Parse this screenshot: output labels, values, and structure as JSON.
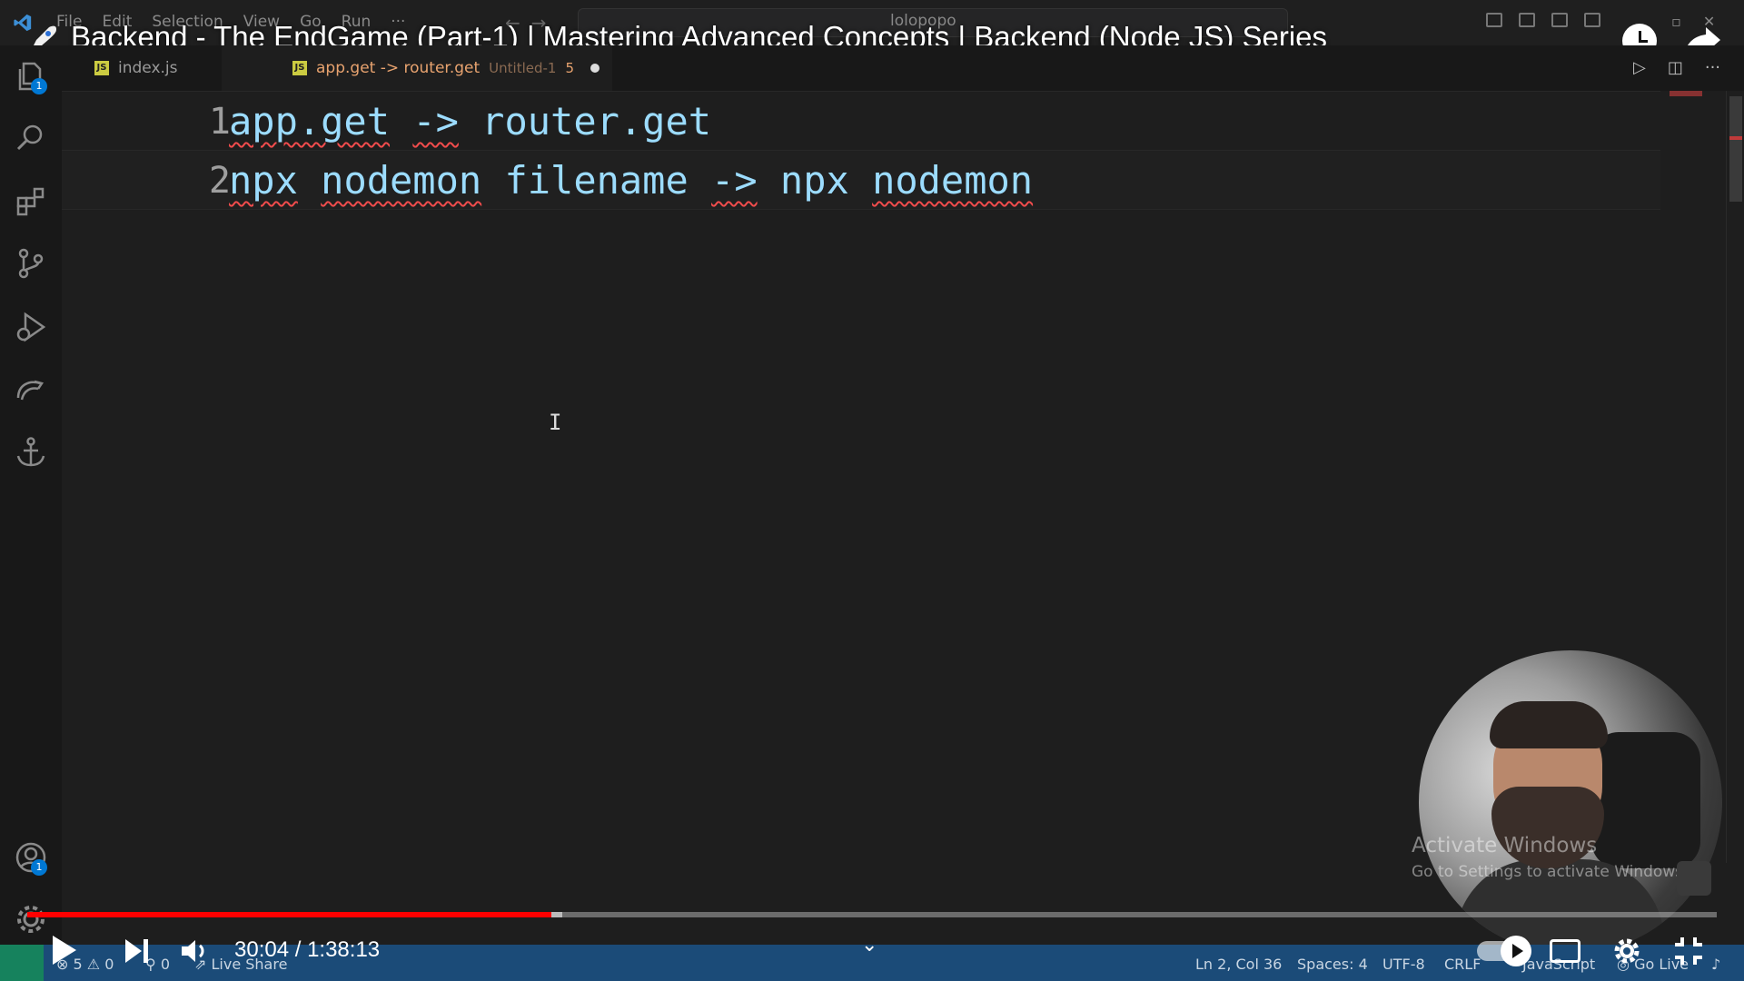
{
  "video": {
    "title": "Backend - The EndGame (Part-1) | Mastering Advanced Concepts | Backend (Node JS) Series",
    "time": "30:04 / 1:38:13",
    "progress_fraction": 0.31
  },
  "menu": [
    "File",
    "Edit",
    "Selection",
    "View",
    "Go",
    "Run",
    "···"
  ],
  "command_center": {
    "text": "lolopopo"
  },
  "tabs": [
    {
      "label": "index.js",
      "active": false
    },
    {
      "label": "app.get -> router.get",
      "sub": "Untitled-1",
      "count": "5",
      "active": true
    }
  ],
  "editor": {
    "lines": [
      {
        "num": "1",
        "tokens": [
          [
            "app.get",
            true
          ],
          [
            " ",
            false
          ],
          [
            "->",
            true
          ],
          [
            " router.get",
            false
          ]
        ]
      },
      {
        "num": "2",
        "tokens": [
          [
            "npx",
            true
          ],
          [
            " ",
            false
          ],
          [
            "nodemon",
            true
          ],
          [
            " filename ",
            false
          ],
          [
            "->",
            true
          ],
          [
            " npx ",
            false
          ],
          [
            "nodemon",
            true
          ]
        ]
      }
    ]
  },
  "watermark": {
    "title": "Activate Windows",
    "subtitle": "Go to Settings to activate Windows."
  },
  "statusbar": {
    "errors": "5",
    "warnings": "0",
    "ports": "0",
    "live_share": "Live Share",
    "position": "Ln 2, Col 36",
    "spaces": "Spaces: 4",
    "encoding": "UTF-8",
    "eol": "CRLF",
    "language": "JavaScript",
    "go_live": "Go Live"
  },
  "badges": {
    "explorer": "1",
    "accounts": "1"
  },
  "colors": {
    "status_bar": "#1b4b78",
    "progress": "#ff0000",
    "code": "#9cdcfe",
    "error_squiggle": "#f14c4c"
  }
}
